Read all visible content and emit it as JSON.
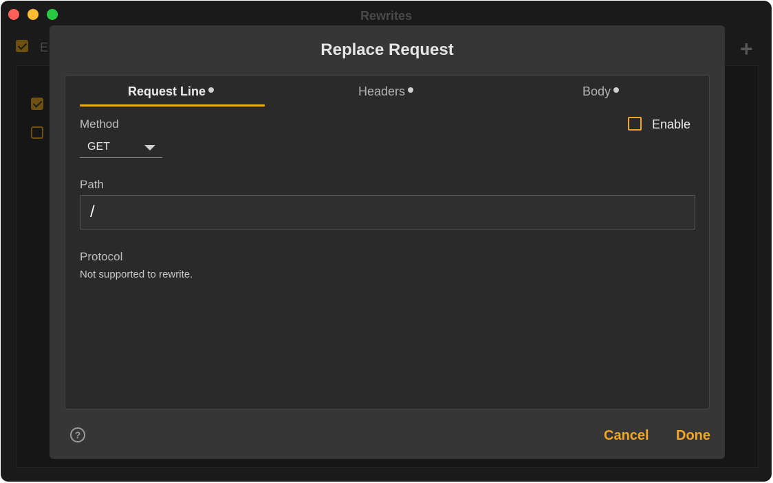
{
  "window": {
    "title": "Rewrites",
    "partial_label": "E"
  },
  "dialog": {
    "title": "Replace Request",
    "tabs": [
      {
        "label": "Request Line",
        "active": true
      },
      {
        "label": "Headers",
        "active": false
      },
      {
        "label": "Body",
        "active": false
      }
    ],
    "method": {
      "label": "Method",
      "value": "GET"
    },
    "enable": {
      "label": "Enable",
      "checked": false
    },
    "path": {
      "label": "Path",
      "value": "/"
    },
    "protocol": {
      "label": "Protocol",
      "note": "Not supported to rewrite."
    },
    "buttons": {
      "cancel": "Cancel",
      "done": "Done",
      "help": "?"
    }
  },
  "colors": {
    "accent": "#f5a623",
    "dialog_bg": "#363636",
    "panel_bg": "#2a2a2a",
    "window_bg": "#1a1a1a"
  },
  "icons": [
    "close-traffic-light",
    "minimize-traffic-light",
    "maximize-traffic-light",
    "plus-icon",
    "chevron-down-icon",
    "help-icon",
    "checkbox-icon"
  ]
}
